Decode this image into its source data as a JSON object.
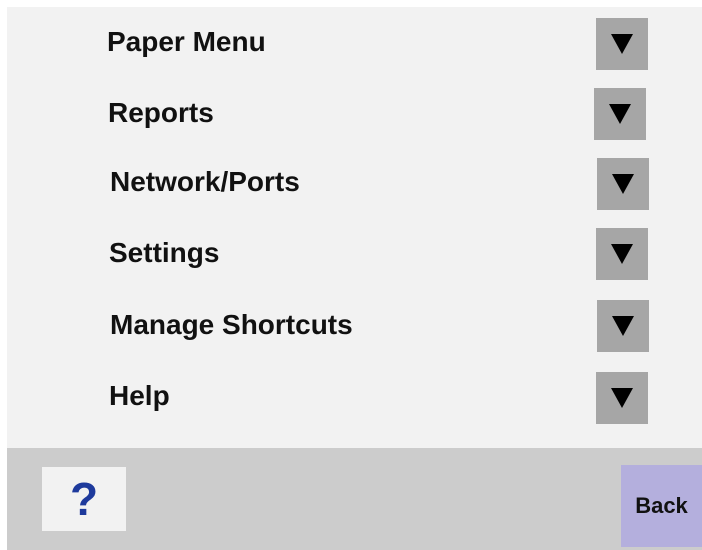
{
  "menu": {
    "items": [
      {
        "label": "Paper Menu"
      },
      {
        "label": "Reports"
      },
      {
        "label": "Network/Ports"
      },
      {
        "label": "Settings"
      },
      {
        "label": "Manage Shortcuts"
      },
      {
        "label": "Help"
      }
    ],
    "expand_icon": "down-triangle-icon"
  },
  "bottom_bar": {
    "help_glyph": "?",
    "help_icon": "question-mark-icon",
    "back_label": "Back"
  },
  "colors": {
    "panel_background": "#f2f2f2",
    "arrow_button": "#a6a6a6",
    "bottom_bar": "#cccccc",
    "back_button": "#b4afdd",
    "help_glyph": "#1e3a9c"
  }
}
